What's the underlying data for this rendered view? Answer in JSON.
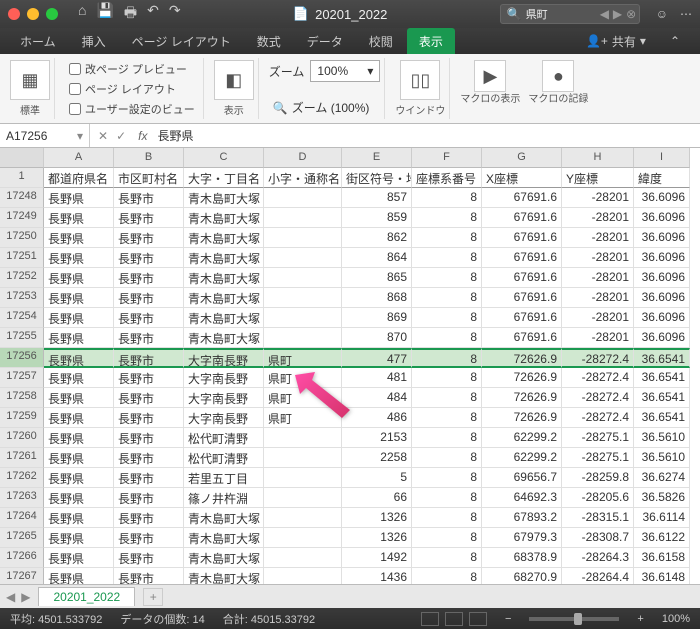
{
  "titlebar": {
    "doc_icon": "📄",
    "title": "20201_2022",
    "search_icon": "🔍",
    "search_value": "県町",
    "user_icon": "☺"
  },
  "tabs": [
    "ホーム",
    "挿入",
    "ページ レイアウト",
    "数式",
    "データ",
    "校閲",
    "表示"
  ],
  "active_tab": 6,
  "share_label": "共有",
  "ribbon": {
    "normal_label": "標準",
    "preview": "改ページ プレビュー",
    "page_layout": "ページ レイアウト",
    "user_view": "ユーザー設定のビュー",
    "show_label": "表示",
    "zoom_label": "ズーム",
    "zoom_value": "100%",
    "zoom100": "ズーム (100%)",
    "window_label": "ウインドウ",
    "macro_show": "マクロの表示",
    "macro_rec": "マクロの記録"
  },
  "formula": {
    "name_box": "A17256",
    "fx_label": "fx",
    "content": "長野県"
  },
  "col_letters": [
    "A",
    "B",
    "C",
    "D",
    "E",
    "F",
    "G",
    "H",
    "I"
  ],
  "headers": [
    "都道府県名",
    "市区町村名",
    "大字・丁目名",
    "小字・通称名",
    "街区符号・地",
    "座標系番号",
    "X座標",
    "Y座標",
    "緯度"
  ],
  "selected_row": 8,
  "rows": [
    {
      "n": "1",
      "c": [
        "都道府県名",
        "市区町村名",
        "大字・丁目名",
        "小字・通称名",
        "街区符号・地",
        "座標系番号",
        "X座標",
        "Y座標",
        "緯度"
      ],
      "hdr": true
    },
    {
      "n": "17248",
      "c": [
        "長野県",
        "長野市",
        "青木島町大塚",
        "",
        "857",
        "8",
        "67691.6",
        "-28201",
        "36.6096"
      ]
    },
    {
      "n": "17249",
      "c": [
        "長野県",
        "長野市",
        "青木島町大塚",
        "",
        "859",
        "8",
        "67691.6",
        "-28201",
        "36.6096"
      ]
    },
    {
      "n": "17250",
      "c": [
        "長野県",
        "長野市",
        "青木島町大塚",
        "",
        "862",
        "8",
        "67691.6",
        "-28201",
        "36.6096"
      ]
    },
    {
      "n": "17251",
      "c": [
        "長野県",
        "長野市",
        "青木島町大塚",
        "",
        "864",
        "8",
        "67691.6",
        "-28201",
        "36.6096"
      ]
    },
    {
      "n": "17252",
      "c": [
        "長野県",
        "長野市",
        "青木島町大塚",
        "",
        "865",
        "8",
        "67691.6",
        "-28201",
        "36.6096"
      ]
    },
    {
      "n": "17253",
      "c": [
        "長野県",
        "長野市",
        "青木島町大塚",
        "",
        "868",
        "8",
        "67691.6",
        "-28201",
        "36.6096"
      ]
    },
    {
      "n": "17254",
      "c": [
        "長野県",
        "長野市",
        "青木島町大塚",
        "",
        "869",
        "8",
        "67691.6",
        "-28201",
        "36.6096"
      ]
    },
    {
      "n": "17255",
      "c": [
        "長野県",
        "長野市",
        "青木島町大塚",
        "",
        "870",
        "8",
        "67691.6",
        "-28201",
        "36.6096"
      ]
    },
    {
      "n": "17256",
      "c": [
        "長野県",
        "長野市",
        "大字南長野",
        "県町",
        "477",
        "8",
        "72626.9",
        "-28272.4",
        "36.6541"
      ]
    },
    {
      "n": "17257",
      "c": [
        "長野県",
        "長野市",
        "大字南長野",
        "県町",
        "481",
        "8",
        "72626.9",
        "-28272.4",
        "36.6541"
      ]
    },
    {
      "n": "17258",
      "c": [
        "長野県",
        "長野市",
        "大字南長野",
        "県町",
        "484",
        "8",
        "72626.9",
        "-28272.4",
        "36.6541"
      ]
    },
    {
      "n": "17259",
      "c": [
        "長野県",
        "長野市",
        "大字南長野",
        "県町",
        "486",
        "8",
        "72626.9",
        "-28272.4",
        "36.6541"
      ]
    },
    {
      "n": "17260",
      "c": [
        "長野県",
        "長野市",
        "松代町清野",
        "",
        "2153",
        "8",
        "62299.2",
        "-28275.1",
        "36.5610"
      ]
    },
    {
      "n": "17261",
      "c": [
        "長野県",
        "長野市",
        "松代町清野",
        "",
        "2258",
        "8",
        "62299.2",
        "-28275.1",
        "36.5610"
      ]
    },
    {
      "n": "17262",
      "c": [
        "長野県",
        "長野市",
        "若里五丁目",
        "",
        "5",
        "8",
        "69656.7",
        "-28259.8",
        "36.6274"
      ]
    },
    {
      "n": "17263",
      "c": [
        "長野県",
        "長野市",
        "篠ノ井杵淵",
        "",
        "66",
        "8",
        "64692.3",
        "-28205.6",
        "36.5826"
      ]
    },
    {
      "n": "17264",
      "c": [
        "長野県",
        "長野市",
        "青木島町大塚",
        "",
        "1326",
        "8",
        "67893.2",
        "-28315.1",
        "36.6114"
      ]
    },
    {
      "n": "17265",
      "c": [
        "長野県",
        "長野市",
        "青木島町大塚",
        "",
        "1326",
        "8",
        "67979.3",
        "-28308.7",
        "36.6122"
      ]
    },
    {
      "n": "17266",
      "c": [
        "長野県",
        "長野市",
        "青木島町大塚",
        "",
        "1492",
        "8",
        "68378.9",
        "-28264.3",
        "36.6158"
      ]
    },
    {
      "n": "17267",
      "c": [
        "長野県",
        "長野市",
        "青木島町大塚",
        "",
        "1436",
        "8",
        "68270.9",
        "-28264.4",
        "36.6148"
      ]
    }
  ],
  "sheet_tab": "20201_2022",
  "status": {
    "avg_label": "平均:",
    "avg": "4501.533792",
    "count_label": "データの個数:",
    "count": "14",
    "sum_label": "合計:",
    "sum": "45015.33792",
    "zoom": "100%"
  }
}
